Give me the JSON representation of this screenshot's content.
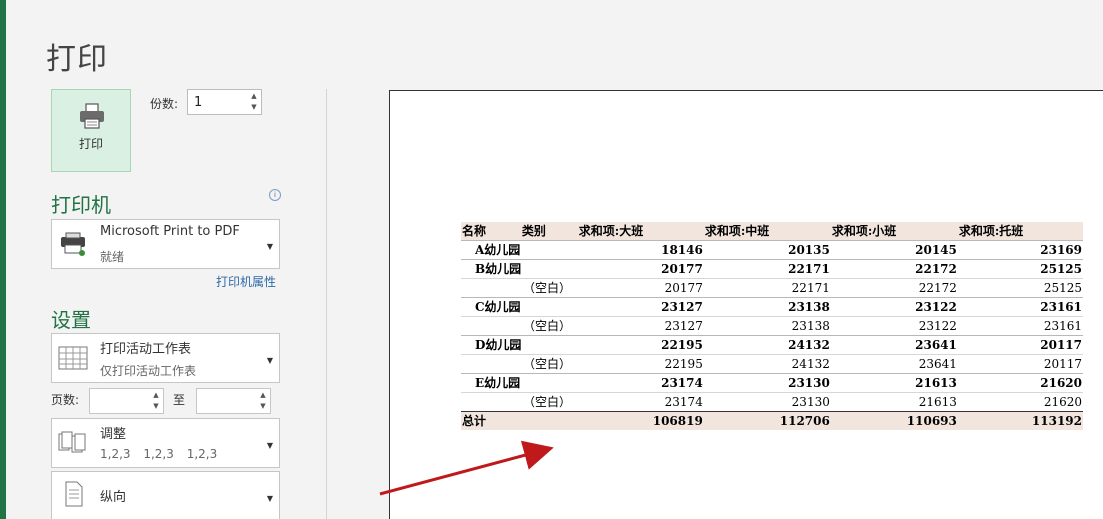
{
  "page": {
    "title": "打印"
  },
  "print_button": {
    "label": "打印"
  },
  "copies": {
    "label": "份数:",
    "value": "1"
  },
  "printer": {
    "section_title": "打印机",
    "name": "Microsoft Print to PDF",
    "status": "就绪",
    "properties_link": "打印机属性"
  },
  "settings": {
    "section_title": "设置",
    "scope": {
      "main": "打印活动工作表",
      "sub": "仅打印活动工作表"
    },
    "pages_label": "页数:",
    "to_label": "至",
    "collate": {
      "main": "调整",
      "sub": "1,2,3 1,2,3 1,2,3"
    },
    "orientation": {
      "main": "纵向"
    }
  },
  "preview": {
    "headers": [
      "名称",
      "类别",
      "求和项:大班",
      "求和项:中班",
      "求和项:小班",
      "求和项:托班"
    ],
    "rows": [
      {
        "kind": "bold",
        "name": "A幼儿园",
        "cat": "",
        "v": [
          "18146",
          "20135",
          "20145",
          "23169"
        ]
      },
      {
        "kind": "bold",
        "name": "B幼儿园",
        "cat": "",
        "v": [
          "20177",
          "22171",
          "22172",
          "25125"
        ]
      },
      {
        "kind": "norm",
        "name": "",
        "cat": "（空白）",
        "v": [
          "20177",
          "22171",
          "22172",
          "25125"
        ]
      },
      {
        "kind": "bold",
        "name": "C幼儿园",
        "cat": "",
        "v": [
          "23127",
          "23138",
          "23122",
          "23161"
        ]
      },
      {
        "kind": "norm",
        "name": "",
        "cat": "（空白）",
        "v": [
          "23127",
          "23138",
          "23122",
          "23161"
        ]
      },
      {
        "kind": "bold",
        "name": "D幼儿园",
        "cat": "",
        "v": [
          "22195",
          "24132",
          "23641",
          "20117"
        ]
      },
      {
        "kind": "norm",
        "name": "",
        "cat": "（空白）",
        "v": [
          "22195",
          "24132",
          "23641",
          "20117"
        ]
      },
      {
        "kind": "bold",
        "name": "E幼儿园",
        "cat": "",
        "v": [
          "23174",
          "23130",
          "21613",
          "21620"
        ]
      },
      {
        "kind": "norm",
        "name": "",
        "cat": "（空白）",
        "v": [
          "23174",
          "23130",
          "21613",
          "21620"
        ]
      }
    ],
    "total": {
      "label": "总计",
      "v": [
        "106819",
        "112706",
        "110693",
        "113192"
      ]
    }
  },
  "colors": {
    "accent": "#217346",
    "print_button_bg": "#d9f0e2",
    "header_bg": "#f2e5dd",
    "arrow": "#c0191c"
  },
  "icons": [
    "printer-icon",
    "info-icon",
    "sheet-grid-icon",
    "collate-icon",
    "portrait-page-icon",
    "chevron-down-icon"
  ]
}
